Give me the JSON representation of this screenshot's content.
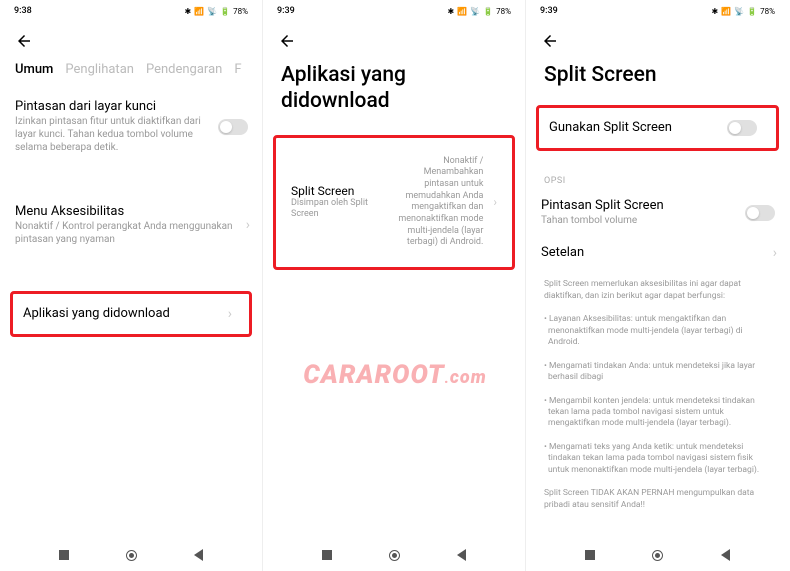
{
  "watermark": {
    "brand": "CARAROOT",
    "dot": ".",
    "suffix": "com"
  },
  "phone1": {
    "status": {
      "time": "9:38",
      "battery": "78%"
    },
    "tabs": [
      "Umum",
      "Penglihatan",
      "Pendengaran",
      "F"
    ],
    "item1": {
      "title": "Pintasan dari layar kunci",
      "desc": "Izinkan pintasan fitur untuk diaktifkan dari layar kunci. Tahan kedua tombol volume selama beberapa detik."
    },
    "item2": {
      "title": "Menu Aksesibilitas",
      "desc": "Nonaktif / Kontrol perangkat Anda menggunakan pintasan yang nyaman"
    },
    "item3": {
      "title": "Aplikasi yang didownload"
    }
  },
  "phone2": {
    "status": {
      "time": "9:39",
      "battery": "78%"
    },
    "title": "Aplikasi yang didownload",
    "item1": {
      "title": "Split Screen",
      "subtitle": "Disimpan oleh Split Screen",
      "right": "Nonaktif / Menambahkan pintasan untuk memudahkan Anda mengaktifkan dan menonaktifkan mode multi-jendela (layar terbagi) di Android."
    }
  },
  "phone3": {
    "status": {
      "time": "9:39",
      "battery": "78%"
    },
    "title": "Split Screen",
    "item1": {
      "title": "Gunakan Split Screen"
    },
    "section": "OPSI",
    "item2": {
      "title": "Pintasan Split Screen",
      "desc": "Tahan tombol volume"
    },
    "item3": {
      "title": "Setelan"
    },
    "info1": "Split Screen memerlukan aksesibilitas ini agar dapat diaktifkan, dan izin berikut agar dapat berfungsi:",
    "info2": "• Layanan Aksesibilitas: untuk mengaktifkan dan menonaktifkan mode multi-jendela (layar terbagi) di Android.",
    "info3": "• Mengamati tindakan Anda: untuk mendeteksi jika layar berhasil dibagi",
    "info4": "• Mengambil konten jendela: untuk mendeteksi tindakan tekan lama pada tombol navigasi sistem untuk mengaktifkan mode multi-jendela (layar terbagi).",
    "info5": "• Mengamati teks yang Anda ketik: untuk mendeteksi tindakan tekan lama pada tombol navigasi sistem fisik untuk menonaktifkan mode multi-jendela (layar terbagi).",
    "info6": "Split Screen TIDAK AKAN PERNAH mengumpulkan data pribadi atau sensitif Anda!!"
  }
}
